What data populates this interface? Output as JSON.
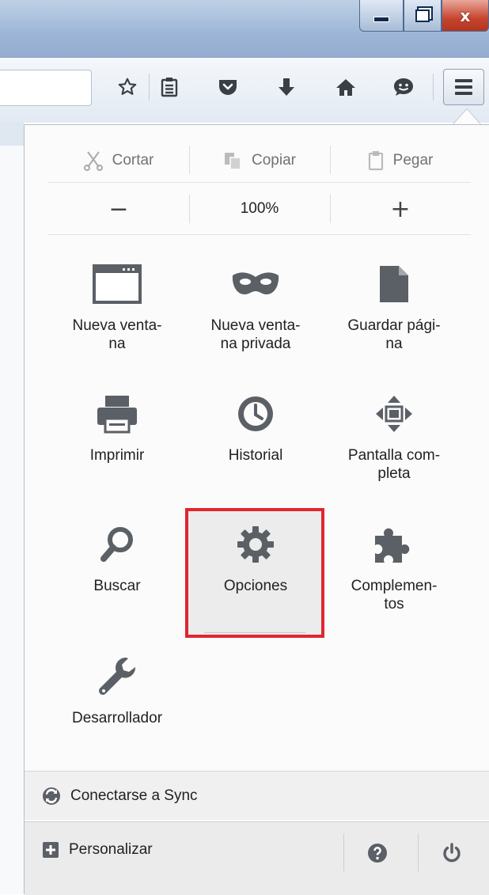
{
  "window": {
    "minimize_icon": "minimize-icon",
    "maximize_icon": "restore-icon",
    "close_label": "x"
  },
  "toolbar": {
    "icons": [
      "star-icon",
      "reading-list-icon",
      "pocket-icon",
      "download-icon",
      "home-icon",
      "hello-chat-icon",
      "hamburger-menu-icon"
    ]
  },
  "menu": {
    "edit": {
      "cut": "Cortar",
      "copy": "Copiar",
      "paste": "Pegar"
    },
    "zoom": {
      "minus": "−",
      "level": "100%",
      "plus": "+"
    },
    "items": [
      {
        "label": "Nueva venta-\nna",
        "icon": "new-window-icon"
      },
      {
        "label": "Nueva venta-\nna privada",
        "icon": "private-mask-icon"
      },
      {
        "label": "Guardar pági-\nna",
        "icon": "save-page-icon"
      },
      {
        "label": "Imprimir",
        "icon": "printer-icon"
      },
      {
        "label": "Historial",
        "icon": "history-clock-icon"
      },
      {
        "label": "Pantalla com-\npleta",
        "icon": "fullscreen-icon"
      },
      {
        "label": "Buscar",
        "icon": "search-icon"
      },
      {
        "label": "Opciones",
        "icon": "gear-icon"
      },
      {
        "label": "Complemen-\ntos",
        "icon": "puzzle-icon"
      },
      {
        "label": "Desarrollador",
        "icon": "wrench-icon"
      }
    ],
    "sync_label": "Conectarse a Sync",
    "customize_label": "Personalizar"
  },
  "colors": {
    "highlight_border": "#e0262e",
    "icon_gray": "#5b5f66"
  }
}
